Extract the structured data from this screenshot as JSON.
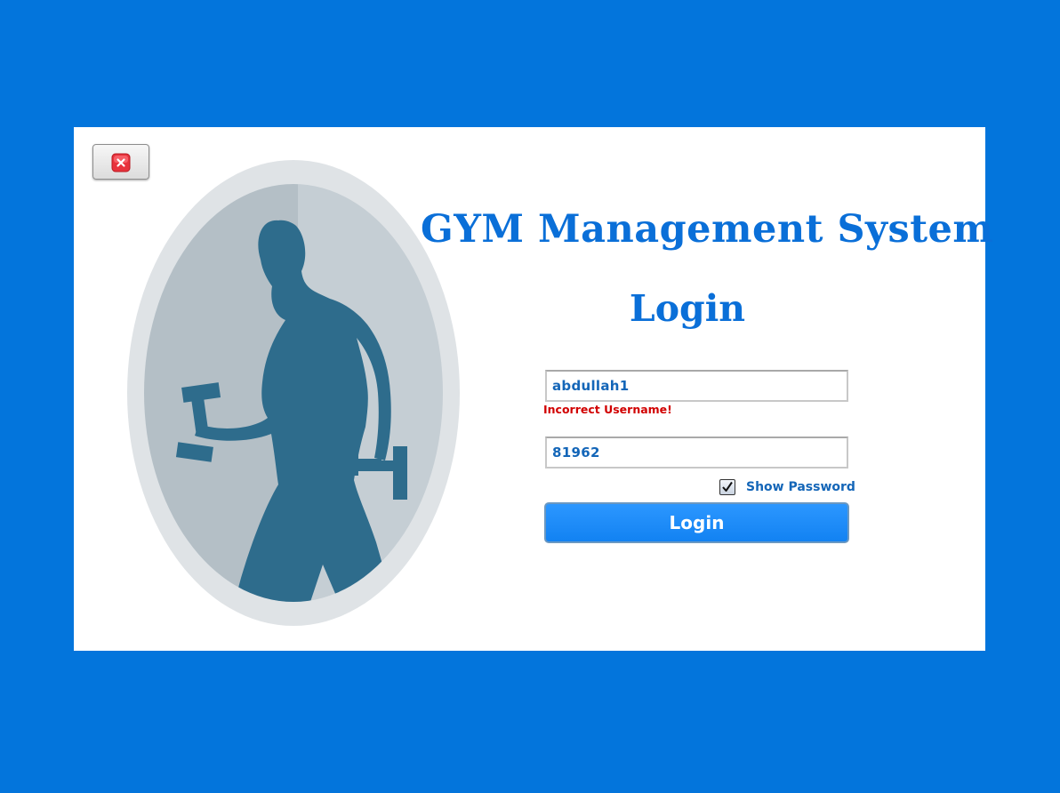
{
  "window": {
    "close_icon": "close-icon"
  },
  "header": {
    "title": "GYM Management System",
    "subtitle": "Login"
  },
  "form": {
    "username": {
      "value": "abdullah1",
      "error": "Incorrect Username!"
    },
    "password": {
      "value": "81962"
    },
    "show_password": {
      "label": "Show Password",
      "checked": true
    },
    "login_button": "Login"
  },
  "image": {
    "icon": "athlete-with-dumbbells-illustration"
  },
  "colors": {
    "background": "#0375dc",
    "accent": "#0a6fd8",
    "error": "#d10000",
    "button": "#1886f7",
    "figure": "#2e6c8c"
  }
}
